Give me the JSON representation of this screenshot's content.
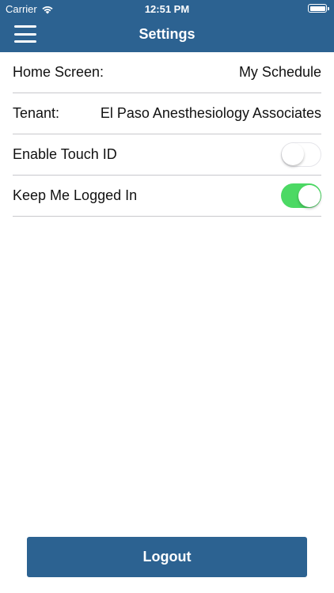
{
  "status_bar": {
    "carrier": "Carrier",
    "time": "12:51 PM",
    "icons": [
      "wifi-icon",
      "battery-icon"
    ]
  },
  "header": {
    "title": "Settings",
    "menu_icon": "hamburger-menu-icon",
    "background": "#2c6291"
  },
  "settings": {
    "home_screen": {
      "label": "Home Screen:",
      "value": "My Schedule"
    },
    "tenant": {
      "label": "Tenant:",
      "value": "El Paso Anesthesiology Associates"
    },
    "touch_id": {
      "label": "Enable Touch ID",
      "enabled": false
    },
    "keep_logged_in": {
      "label": "Keep Me Logged In",
      "enabled": true
    }
  },
  "logout_label": "Logout",
  "colors": {
    "accent": "#2c6291",
    "toggle_on": "#4cd964",
    "divider": "#c8c8cc"
  }
}
